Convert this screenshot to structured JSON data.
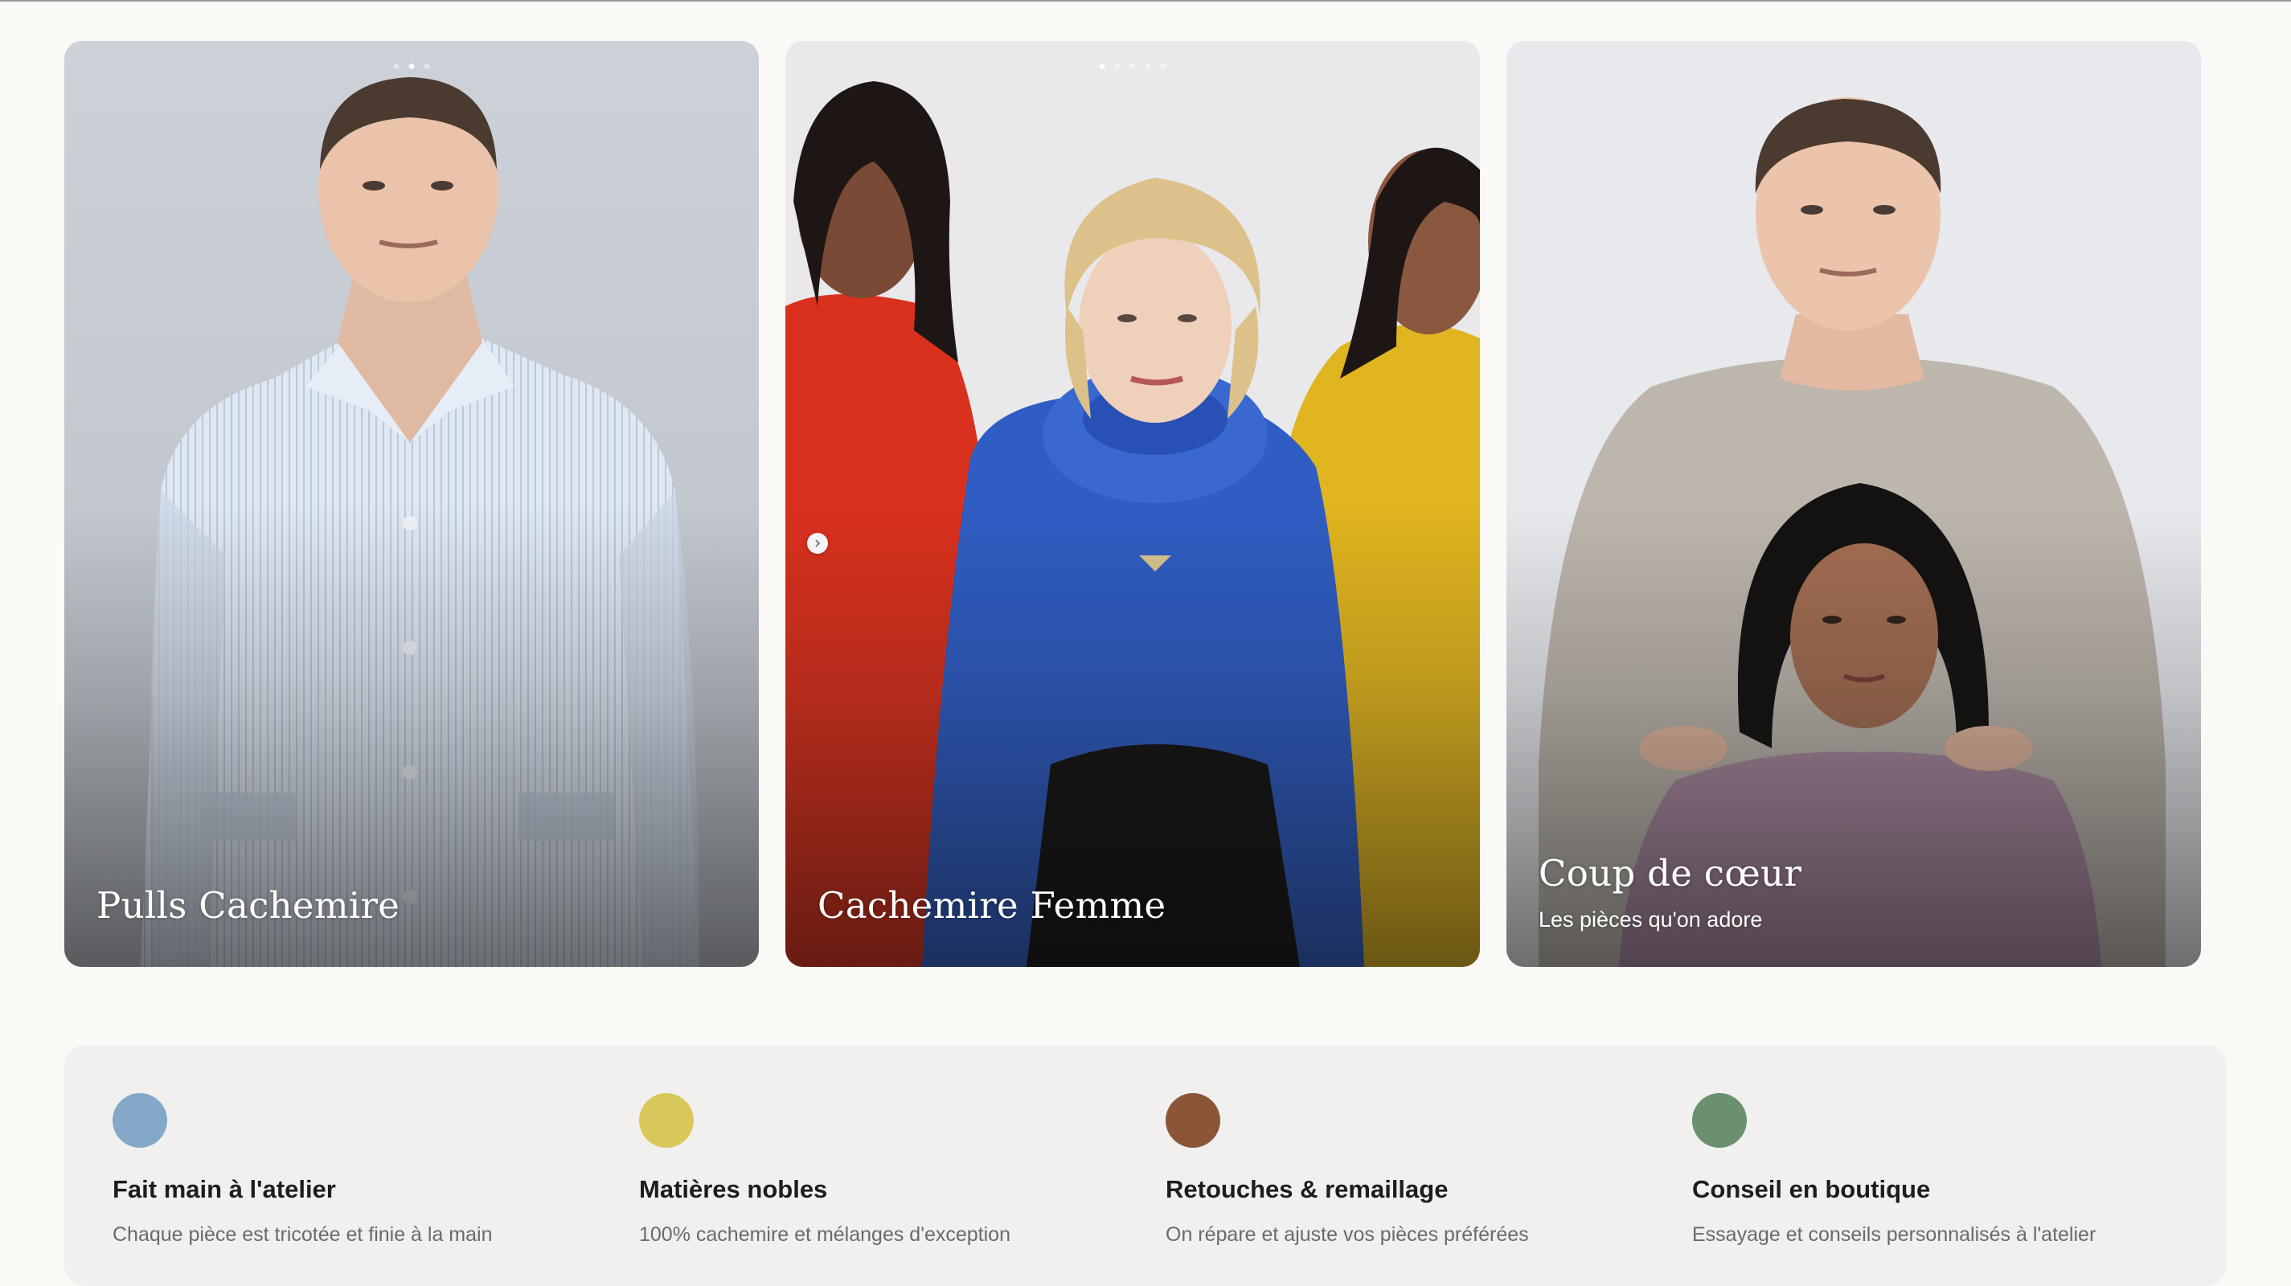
{
  "cards": [
    {
      "title": "Pulls Cachemire",
      "subtitle": "",
      "photo": "young man in pale blue striped shirt against grey studio backdrop",
      "slides": 3,
      "active_slide": 2
    },
    {
      "title": "Cachemire Femme",
      "subtitle": "",
      "photo": "blonde woman in royal blue cowl-neck knit flanked by two girls in red and yellow sweaters",
      "slides": 5,
      "active_slide": 1
    },
    {
      "title": "Coup de cœur",
      "subtitle": "Les pièces qu'on adore",
      "photo": "young man in grey crewneck sweater standing behind a girl in lilac sweater"
    }
  ],
  "carousel": {
    "next_icon": "chevron-right-icon"
  },
  "features": [
    {
      "title": "Fait main à l'atelier",
      "description": "Chaque pièce est tricotée et finie à la main",
      "color": "#84a8c8"
    },
    {
      "title": "Matières nobles",
      "description": "100% cachemire et mélanges d'exception",
      "color": "#d9c95a"
    },
    {
      "title": "Retouches & remaillage",
      "description": "On répare et ajuste vos pièces préférées",
      "color": "#8b5538"
    },
    {
      "title": "Conseil en boutique",
      "description": "Essayage et conseils personnalisés à l'atelier",
      "color": "#6a9070"
    }
  ]
}
